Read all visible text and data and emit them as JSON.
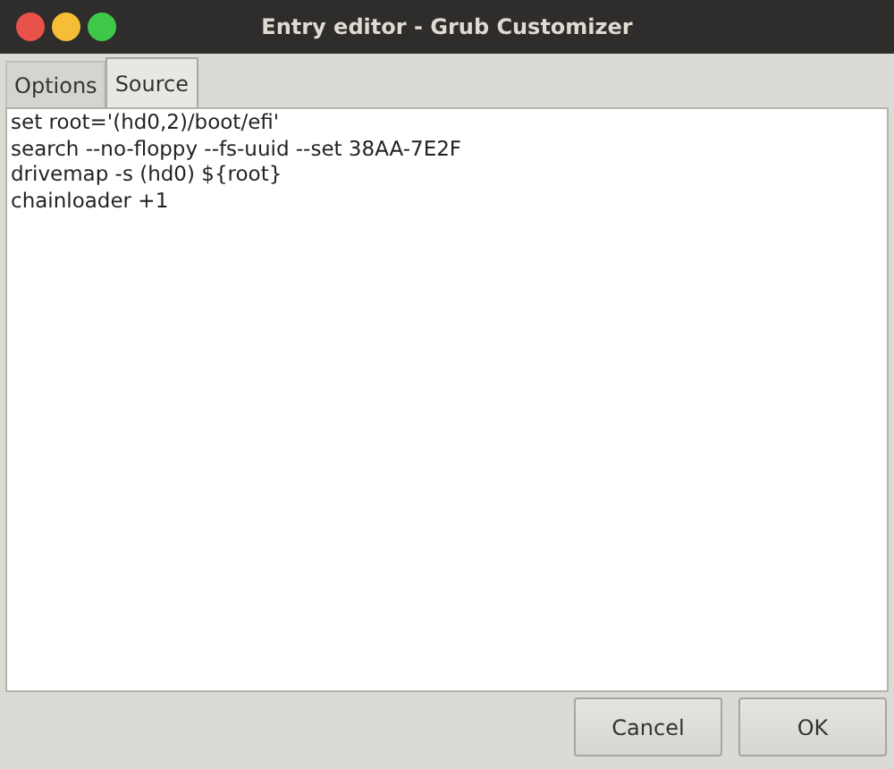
{
  "window": {
    "title": "Entry editor - Grub Customizer"
  },
  "tabs": [
    {
      "label": "Options",
      "selected": false
    },
    {
      "label": "Source",
      "selected": true
    }
  ],
  "editor": {
    "lines": [
      "set root='(hd0,2)/boot/efi'",
      "search --no-floppy --fs-uuid --set 38AA-7E2F",
      "drivemap -s (hd0) ${root}",
      "chainloader +1"
    ]
  },
  "buttons": [
    "Cancel",
    "OK"
  ]
}
